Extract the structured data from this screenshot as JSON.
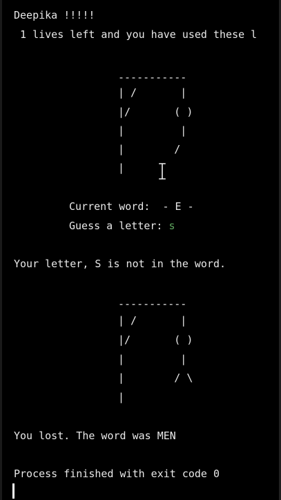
{
  "terminal": {
    "greeting": "Deepika !!!!!",
    "status_line": " 1 lives left and you have used these l",
    "gallows_1": [
      "-----------",
      "| /       |",
      "|/       ( )",
      "|         |",
      "|        /",
      "|"
    ],
    "current_word_label": "Current word:  - E -",
    "guess_prompt": "Guess a letter: ",
    "guess_value": "s",
    "feedback": "Your letter, S is not in the word.",
    "gallows_2": [
      "-----------",
      "| /       |",
      "|/       ( )",
      "|         |",
      "|        / \\",
      "|"
    ],
    "result": "You lost. The word was MEN",
    "process_exit": "Process finished with exit code 0"
  },
  "colors": {
    "background": "#000000",
    "text": "#e8e8e8",
    "input_text": "#5fa85f",
    "cursor": "#ffffff"
  },
  "icons": {
    "mouse_pointer": "text-ibeam-cursor-icon"
  }
}
